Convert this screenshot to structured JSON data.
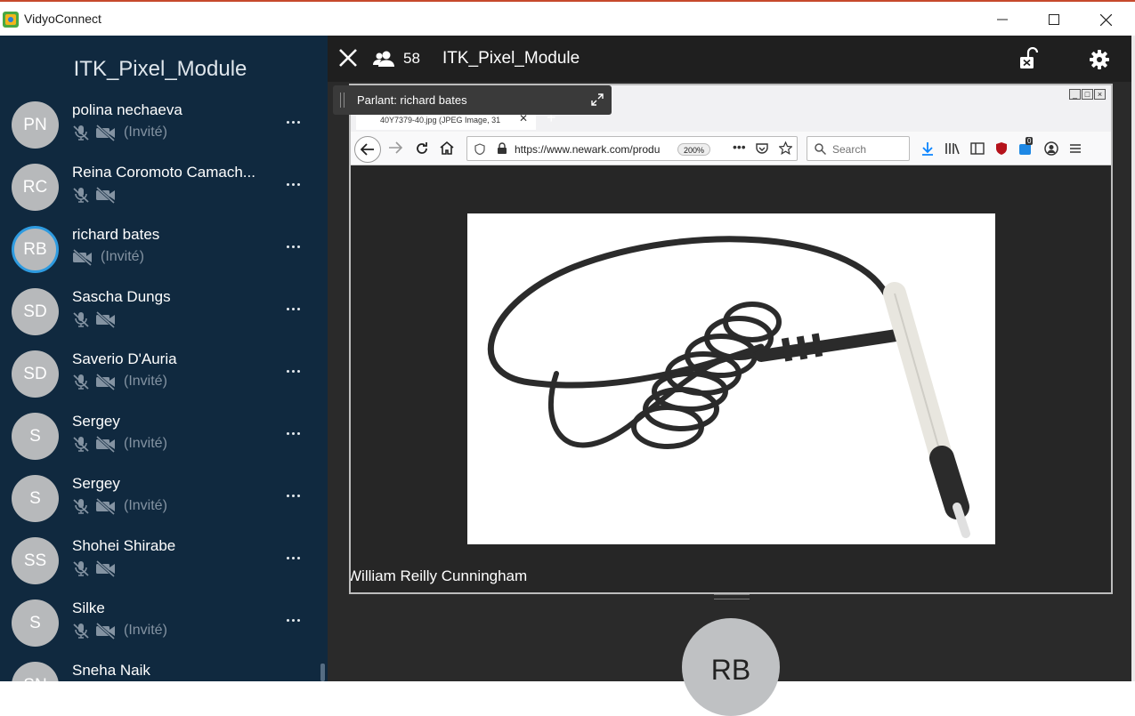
{
  "window": {
    "title": "VidyoConnect"
  },
  "sidebar": {
    "title": "ITK_Pixel_Module",
    "participants": [
      {
        "initials": "PN",
        "name": "polina nechaeva",
        "status": "(Invité)",
        "mic_muted": true,
        "video_off": true,
        "active": false
      },
      {
        "initials": "RC",
        "name": "Reina Coromoto Camach...",
        "status": "",
        "mic_muted": true,
        "video_off": true,
        "active": false
      },
      {
        "initials": "RB",
        "name": "richard bates",
        "status": "(Invité)",
        "mic_muted": false,
        "video_off": true,
        "active": true
      },
      {
        "initials": "SD",
        "name": "Sascha Dungs",
        "status": "",
        "mic_muted": true,
        "video_off": true,
        "active": false
      },
      {
        "initials": "SD",
        "name": "Saverio D'Auria",
        "status": "(Invité)",
        "mic_muted": true,
        "video_off": true,
        "active": false
      },
      {
        "initials": "S",
        "name": "Sergey",
        "status": "(Invité)",
        "mic_muted": true,
        "video_off": true,
        "active": false
      },
      {
        "initials": "S",
        "name": "Sergey",
        "status": "(Invité)",
        "mic_muted": true,
        "video_off": true,
        "active": false
      },
      {
        "initials": "SS",
        "name": "Shohei Shirabe",
        "status": "",
        "mic_muted": true,
        "video_off": true,
        "active": false
      },
      {
        "initials": "S",
        "name": "Silke",
        "status": "(Invité)",
        "mic_muted": true,
        "video_off": true,
        "active": false
      },
      {
        "initials": "SN",
        "name": "Sneha Naik",
        "status": "",
        "mic_muted": true,
        "video_off": true,
        "active": false
      }
    ]
  },
  "main": {
    "participant_count": "58",
    "conference_name": "ITK_Pixel_Module",
    "speaker_label": "Parlant: richard bates",
    "caption": "William Reilly Cunningham",
    "bottom_avatar": "RB"
  },
  "browser": {
    "tab_title": "40Y7379-40.jpg (JPEG Image, 31",
    "url": "https://www.newark.com/produ",
    "zoom": "200%",
    "search_placeholder": "Search",
    "badge_count": "0"
  },
  "colors": {
    "sidebar_bg": "#10293f",
    "accent": "#2e9be0",
    "main_bg": "#2a2a2a"
  }
}
